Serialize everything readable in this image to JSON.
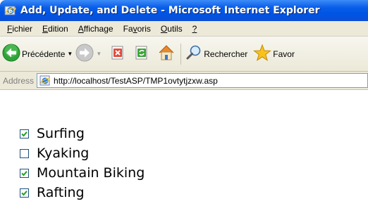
{
  "window": {
    "title": "Add, Update, and Delete - Microsoft Internet Explorer"
  },
  "menu": {
    "items": [
      {
        "label": "Fichier",
        "accel": "F",
        "rest": "ichier"
      },
      {
        "label": "Edition",
        "accel": "E",
        "rest": "dition"
      },
      {
        "label": "Affichage",
        "accel": "A",
        "rest": "ffichage"
      },
      {
        "label": "Favoris",
        "pre": "Fa",
        "accel": "v",
        "rest": "oris"
      },
      {
        "label": "Outils",
        "accel": "O",
        "rest": "utils"
      },
      {
        "label": "?",
        "accel": "?",
        "rest": ""
      }
    ]
  },
  "toolbar": {
    "back_label": "Précédente",
    "search_label": "Rechercher",
    "favorites_label": "Favor"
  },
  "address": {
    "label": "Address",
    "url": "http://localhost/TestASP/TMP1ovtytjzxw.asp"
  },
  "activities": [
    {
      "label": "Surfing",
      "checked": true
    },
    {
      "label": "Kyaking",
      "checked": false
    },
    {
      "label": "Mountain Biking",
      "checked": true
    },
    {
      "label": "Rafting",
      "checked": true
    }
  ],
  "colors": {
    "titlebar": "#0055e5",
    "chrome": "#ece9d8",
    "checkbox_border": "#1c5180",
    "checkmark": "#21a121"
  }
}
